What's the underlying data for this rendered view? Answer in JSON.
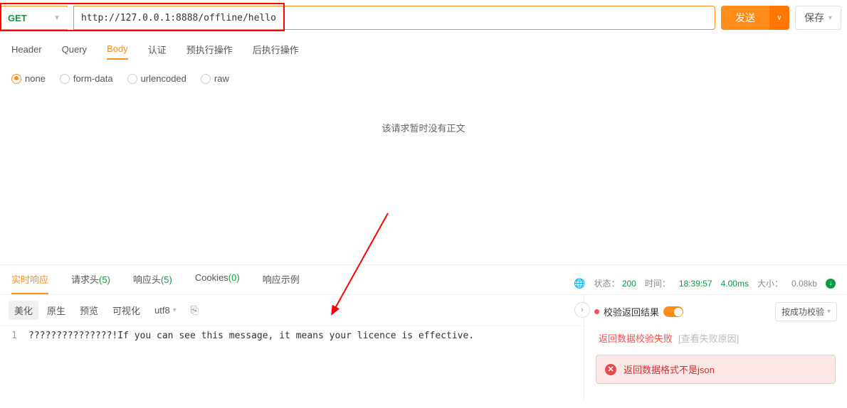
{
  "request": {
    "method": "GET",
    "url": "http://127.0.0.1:8888/offline/hello",
    "sendLabel": "发送",
    "saveLabel": "保存"
  },
  "tabs": {
    "items": [
      "Header",
      "Query",
      "Body",
      "认证",
      "预执行操作",
      "后执行操作"
    ],
    "activeIndex": 2
  },
  "bodyOptions": {
    "items": [
      "none",
      "form-data",
      "urlencoded",
      "raw"
    ],
    "selectedIndex": 0
  },
  "noBodyMessage": "该请求暂时没有正文",
  "response": {
    "tabs": [
      {
        "label": "实时响应",
        "count": ""
      },
      {
        "label": "请求头",
        "count": "(5)"
      },
      {
        "label": "响应头",
        "count": "(5)"
      },
      {
        "label": "Cookies",
        "count": "(0)"
      },
      {
        "label": "响应示例",
        "count": ""
      }
    ],
    "activeTabIndex": 0,
    "status": {
      "stateLabel": "状态：",
      "code": "200",
      "timeLabel": "时间：",
      "timestamp": "18:39:57",
      "duration": "4.00ms",
      "sizeLabel": "大小：",
      "size": "0.08kb"
    },
    "toolbar": {
      "items": [
        "美化",
        "原生",
        "预览",
        "可视化"
      ],
      "activeIndex": 0,
      "encoding": "utf8"
    },
    "code": {
      "lineNum": "1",
      "text": "???????????????!If you can see this message, it means your licence is effective."
    },
    "verify": {
      "title": "校验返回结果",
      "selectLabel": "按成功校验",
      "failMsg": "返回数据校验失败",
      "viewReason": "[查看失败原因]",
      "errorMsg": "返回数据格式不是json"
    }
  }
}
